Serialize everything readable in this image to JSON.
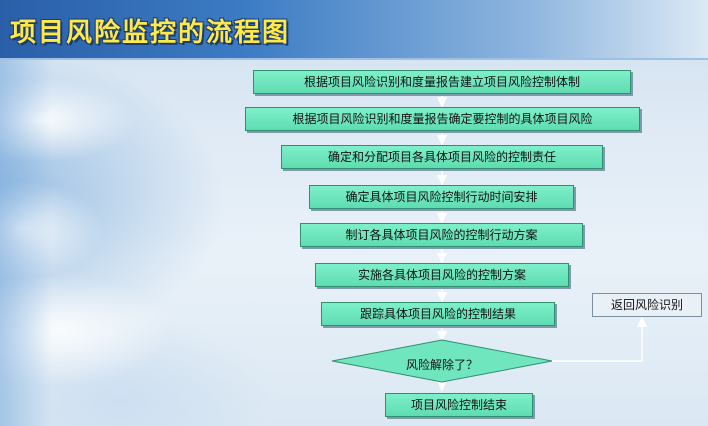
{
  "title": "项目风险监控的流程图",
  "steps": [
    "根据项目风险识别和度量报告建立项目风险控制体制",
    "根据项目风险识别和度量报告确定要控制的具体项目风险",
    "确定和分配项目各具体项目风险的控制责任",
    "确定具体项目风险控制行动时间安排",
    "制订各具体项目风险的控制行动方案",
    "实施各具体项目风险的控制方案",
    "跟踪具体项目风险的控制结果"
  ],
  "decision": "风险解除了？",
  "end": "项目风险控制结束",
  "loop_back": "返回风险识别",
  "colors": {
    "step_fill": "#6fe6be",
    "title_text": "#ffe84a",
    "title_bar": "#2a5fa8"
  }
}
